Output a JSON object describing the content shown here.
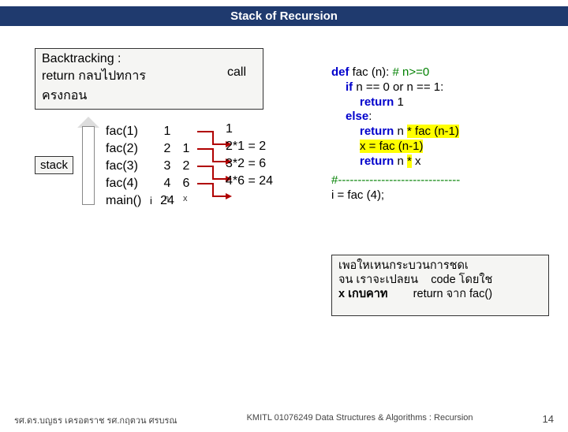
{
  "title": "Stack of Recursion",
  "backtrack": {
    "line1": "Backtracking :",
    "line2a": "return กลบไปทการ",
    "line2b": "ครงกอน",
    "call": "call"
  },
  "stack": {
    "label": "stack",
    "rows": [
      {
        "name": "fac(1)",
        "n": "1",
        "x": ""
      },
      {
        "name": "fac(2)",
        "n": "2",
        "x": "1"
      },
      {
        "name": "fac(3)",
        "n": "3",
        "x": "2"
      },
      {
        "name": "fac(4)",
        "n": "4",
        "x": "6"
      },
      {
        "name": "main()",
        "i": "i",
        "n": "24",
        "x": ""
      }
    ],
    "sub_n": "n",
    "sub_x": "x"
  },
  "results": [
    "1",
    "2*1 = 2",
    "3*2 = 6",
    "4*6 = 24"
  ],
  "code": {
    "l1a": "def",
    "l1b": " fac (n): ",
    "l1c": "# n>=0",
    "l2a": "if",
    "l2b": " n == 0 or n == 1:",
    "l3a": "return",
    "l3b": " 1",
    "l4a": "else",
    "l4b": ":",
    "l5a": "return",
    "l5b": "   n ",
    "l5c": "*",
    "l5d": " fac (n-1)",
    "l6a": "x = fac (n-1)",
    "l7a": "return",
    "l7b": "   n ",
    "l7c": "*",
    "l7d": " x",
    "sep": "#-------------------------------",
    "call": "i = fac (4);"
  },
  "explain": {
    "l1": "เพอใหเหนกระบวนการชดเ",
    "l2a": "จน เราจะเปลยน",
    "l2b": "code โดยใช",
    "l3a": "x เกบคาท",
    "l3b": "return จาก fac()"
  },
  "footer": {
    "left": "รศ.ดร.บญธร     เครอตราช        รศ.กฤตวน  ศรบรณ",
    "mid": "KMITL   01076249 Data Structures & Algorithms : Recursion",
    "page": "14"
  }
}
